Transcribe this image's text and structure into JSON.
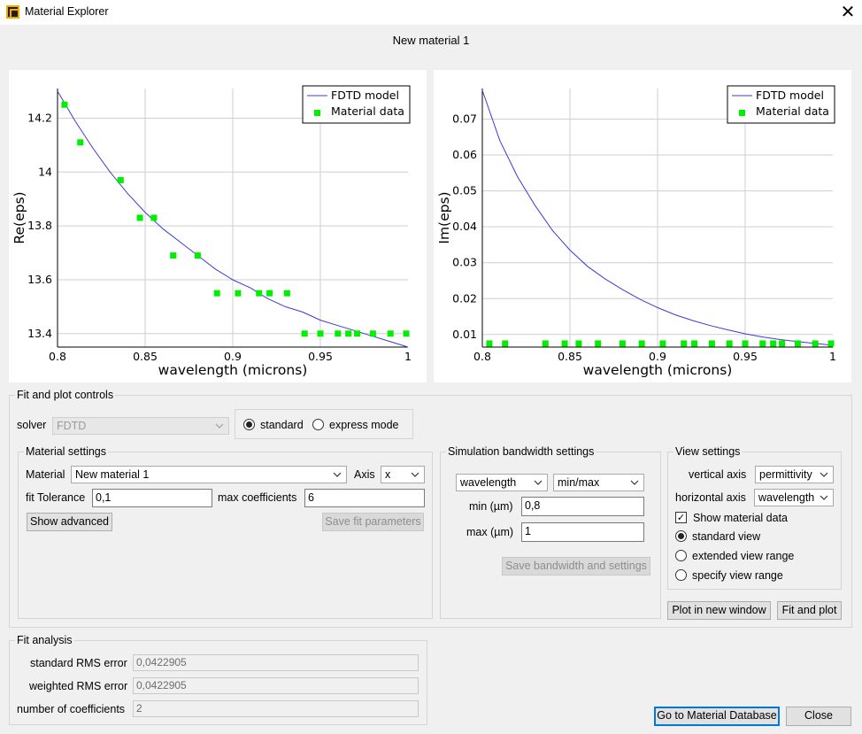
{
  "window": {
    "title": "Material Explorer",
    "close_symbol": "✕",
    "plot_title": "New material 1"
  },
  "chart_data": [
    {
      "type": "scatter",
      "xlabel": "wavelength (microns)",
      "ylabel": "Re(eps)",
      "xlim": [
        0.8,
        1.0
      ],
      "ylim": [
        13.35,
        14.31
      ],
      "x_ticks": [
        "0.8",
        "0.85",
        "0.9",
        "0.95",
        "1"
      ],
      "y_ticks": [
        {
          "v": 13.4,
          "label": "13.4"
        },
        {
          "v": 13.6,
          "label": "13.6"
        },
        {
          "v": 13.8,
          "label": "13.8"
        },
        {
          "v": 14.0,
          "label": "14"
        },
        {
          "v": 14.2,
          "label": "14.2"
        }
      ],
      "legend": [
        "FDTD model",
        "Material data"
      ],
      "legend_position": "top-right",
      "grid": true,
      "model": {
        "name": "FDTD model",
        "color": "#3b3bd6",
        "x": [
          0.8,
          0.81,
          0.82,
          0.83,
          0.84,
          0.85,
          0.86,
          0.87,
          0.88,
          0.89,
          0.9,
          0.91,
          0.92,
          0.93,
          0.94,
          0.95,
          0.96,
          0.97,
          0.98,
          0.99,
          1.0
        ],
        "y": [
          14.3,
          14.19,
          14.09,
          14.0,
          13.92,
          13.85,
          13.79,
          13.74,
          13.69,
          13.64,
          13.6,
          13.57,
          13.53,
          13.5,
          13.48,
          13.45,
          13.43,
          13.41,
          13.39,
          13.37,
          13.35
        ]
      },
      "data": {
        "name": "Material data",
        "color": "#00ee00",
        "x": [
          0.804,
          0.813,
          0.836,
          0.847,
          0.855,
          0.866,
          0.88,
          0.891,
          0.903,
          0.915,
          0.921,
          0.931,
          0.941,
          0.95,
          0.96,
          0.966,
          0.971,
          0.98,
          0.99,
          0.999
        ],
        "y": [
          14.25,
          14.11,
          13.97,
          13.83,
          13.83,
          13.69,
          13.69,
          13.55,
          13.55,
          13.55,
          13.55,
          13.55,
          13.4,
          13.4,
          13.4,
          13.4,
          13.4,
          13.4,
          13.4,
          13.4
        ]
      }
    },
    {
      "type": "scatter",
      "xlabel": "wavelength (microns)",
      "ylabel": "Im(eps)",
      "xlim": [
        0.8,
        1.0
      ],
      "ylim": [
        0.0065,
        0.0785
      ],
      "x_ticks": [
        "0.8",
        "0.85",
        "0.9",
        "0.95",
        "1"
      ],
      "y_ticks": [
        {
          "v": 0.01,
          "label": "0.01"
        },
        {
          "v": 0.02,
          "label": "0.02"
        },
        {
          "v": 0.03,
          "label": "0.03"
        },
        {
          "v": 0.04,
          "label": "0.04"
        },
        {
          "v": 0.05,
          "label": "0.05"
        },
        {
          "v": 0.06,
          "label": "0.06"
        },
        {
          "v": 0.07,
          "label": "0.07"
        }
      ],
      "legend": [
        "FDTD model",
        "Material data"
      ],
      "legend_position": "top-right",
      "grid": true,
      "model": {
        "name": "FDTD model",
        "color": "#3b3bd6",
        "x": [
          0.8,
          0.81,
          0.82,
          0.83,
          0.84,
          0.85,
          0.86,
          0.87,
          0.88,
          0.89,
          0.9,
          0.91,
          0.92,
          0.93,
          0.94,
          0.95,
          0.96,
          0.97,
          0.98,
          0.99,
          1.0
        ],
        "y": [
          0.078,
          0.064,
          0.054,
          0.046,
          0.039,
          0.0335,
          0.029,
          0.0255,
          0.0225,
          0.0198,
          0.0175,
          0.0155,
          0.0139,
          0.0125,
          0.0113,
          0.0102,
          0.0093,
          0.0086,
          0.008,
          0.0075,
          0.007
        ]
      },
      "data": {
        "name": "Material data",
        "color": "#00ee00",
        "x": [
          0.804,
          0.813,
          0.836,
          0.847,
          0.855,
          0.866,
          0.88,
          0.891,
          0.903,
          0.915,
          0.921,
          0.931,
          0.941,
          0.95,
          0.96,
          0.966,
          0.971,
          0.98,
          0.99,
          0.999
        ],
        "y": [
          0.0075,
          0.0075,
          0.0075,
          0.0075,
          0.0075,
          0.0075,
          0.0075,
          0.0075,
          0.0075,
          0.0075,
          0.0075,
          0.0075,
          0.0075,
          0.0075,
          0.0075,
          0.0075,
          0.0075,
          0.0075,
          0.0075,
          0.0075
        ]
      }
    }
  ],
  "fit_plot": {
    "title": "Fit and plot controls",
    "solver_label": "solver",
    "solver_value": "FDTD",
    "mode_standard": "standard",
    "mode_express": "express mode",
    "material_settings": {
      "title": "Material settings",
      "material_label": "Material",
      "material_value": "New material 1",
      "axis_label": "Axis",
      "axis_value": "x",
      "fit_tolerance_label": "fit Tolerance",
      "fit_tolerance_value": "0,1",
      "max_coeff_label": "max coefficients",
      "max_coeff_value": "6",
      "show_advanced": "Show advanced",
      "save_fit": "Save fit parameters"
    },
    "bandwidth": {
      "title": "Simulation bandwidth settings",
      "quantity_value": "wavelength",
      "range_mode_value": "min/max",
      "min_label": "min (µm)",
      "min_value": "0,8",
      "max_label": "max (µm)",
      "max_value": "1",
      "save_button": "Save bandwidth and settings"
    },
    "view": {
      "title": "View settings",
      "vertical_label": "vertical axis",
      "vertical_value": "permittivity",
      "horizontal_label": "horizontal axis",
      "horizontal_value": "wavelength",
      "show_material_data": "Show material data",
      "standard_view": "standard view",
      "extended_view": "extended view range",
      "specify_view": "specify view range"
    },
    "plot_new_window": "Plot in new window",
    "fit_and_plot": "Fit and plot"
  },
  "fit_analysis": {
    "title": "Fit analysis",
    "std_rms_label": "standard RMS error",
    "std_rms_value": "0,0422905",
    "weighted_rms_label": "weighted RMS error",
    "weighted_rms_value": "0,0422905",
    "num_coeff_label": "number of coefficients",
    "num_coeff_value": "2"
  },
  "footer": {
    "goto_db": "Go to Material Database",
    "close": "Close"
  }
}
